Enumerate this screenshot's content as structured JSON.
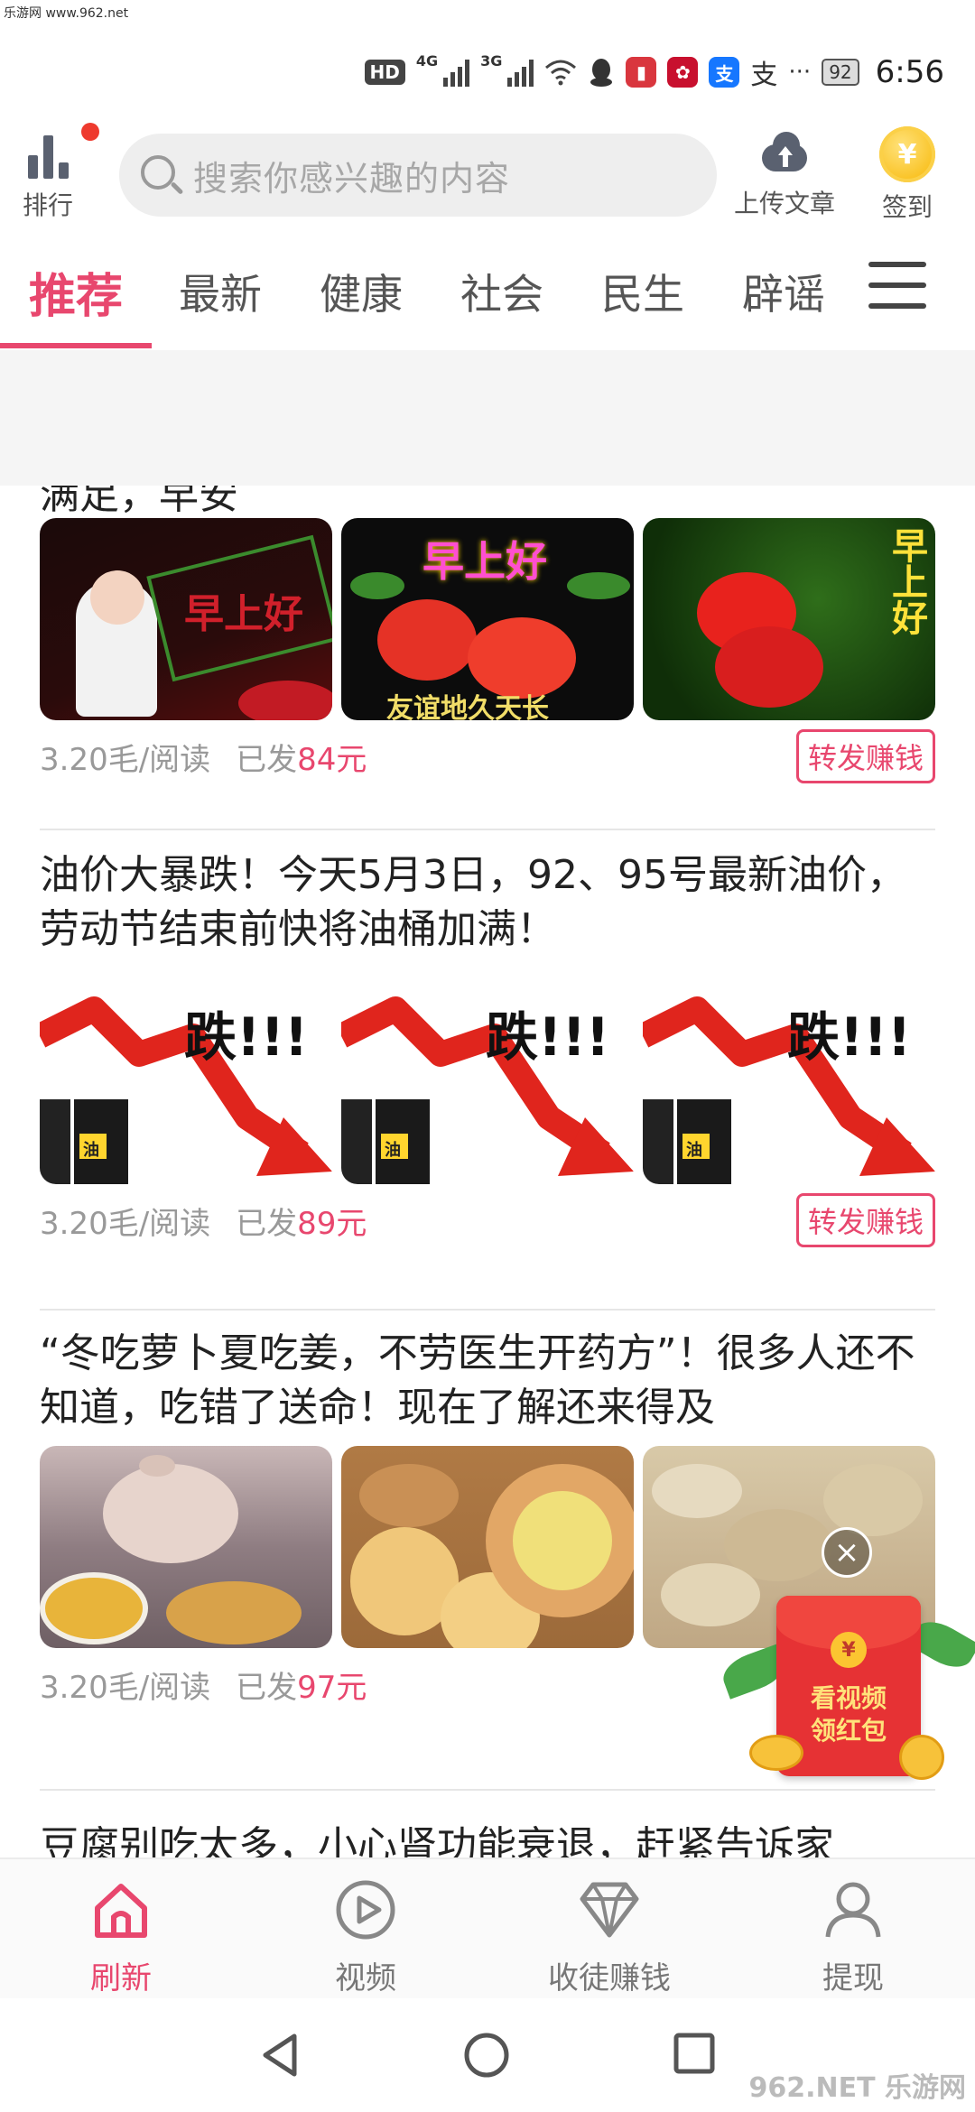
{
  "watermark_top": "乐游网 www.962.net",
  "status_bar": {
    "hd": "HD",
    "net_4g": "4G",
    "net_3g": "3G",
    "more": "···",
    "battery": "92",
    "time": "6:56"
  },
  "topbar": {
    "rank_label": "排行",
    "search_placeholder": "搜索你感兴趣的内容",
    "upload_label": "上传文章",
    "signin_label": "签到",
    "coin_symbol": "¥"
  },
  "tabs": [
    {
      "label": "推荐",
      "active": true
    },
    {
      "label": "最新"
    },
    {
      "label": "健康"
    },
    {
      "label": "社会"
    },
    {
      "label": "民生"
    },
    {
      "label": "辟谣"
    }
  ],
  "feed": {
    "cut_title": "满足，早安",
    "articles": [
      {
        "title": "",
        "thumbs": [
          "早上好",
          "早上好",
          "早上好"
        ],
        "thumb_caption_2": "友谊地久天长",
        "price": "3.20毛/阅读",
        "earned_prefix": "已发",
        "earned_amount": "84元",
        "share_label": "转发赚钱"
      },
      {
        "title": "油价大暴跌！今天5月3日，92、95号最新油价，劳动节结束前快将油桶加满！",
        "thumb_text": "跌!!!",
        "barrel_text": "油",
        "price": "3.20毛/阅读",
        "earned_prefix": "已发",
        "earned_amount": "89元",
        "share_label": "转发赚钱"
      },
      {
        "title": "“冬吃萝卜夏吃姜，不劳医生开药方”！很多人还不知道，吃错了送命！现在了解还来得及",
        "price": "3.20毛/阅读",
        "earned_prefix": "已发",
        "earned_amount": "97元"
      },
      {
        "title": "豆腐别吃太多，小心肾功能衰退，赶紧告诉家"
      }
    ]
  },
  "redpack": {
    "close": "×",
    "coin": "¥",
    "line1": "看视频",
    "line2": "领红包"
  },
  "bottom_nav": [
    {
      "label": "刷新",
      "icon": "home-icon",
      "active": true
    },
    {
      "label": "视频",
      "icon": "play-icon"
    },
    {
      "label": "收徒赚钱",
      "icon": "diamond-icon"
    },
    {
      "label": "提现",
      "icon": "user-icon"
    }
  ],
  "watermark_bottom": "962.NET 乐游网",
  "colors": {
    "accent": "#e8476e",
    "text": "#222222",
    "muted": "#999999"
  }
}
